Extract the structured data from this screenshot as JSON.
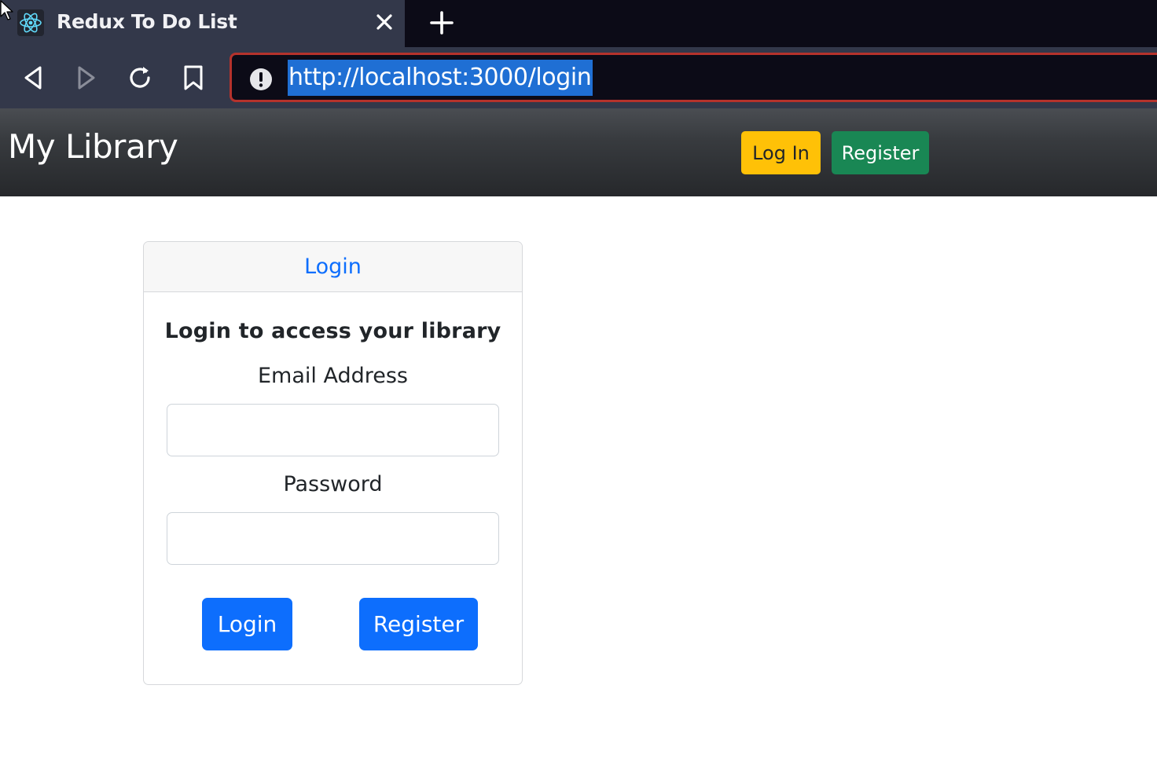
{
  "browser": {
    "tab": {
      "title": "Redux To Do List",
      "favicon": "react-atom-icon"
    },
    "new_tab_icon": "plus-icon",
    "toolbar": {
      "back_icon": "back-triangle-icon",
      "forward_icon": "forward-triangle-icon",
      "reload_icon": "reload-icon",
      "bookmark_icon": "bookmark-icon",
      "info_icon": "info-exclamation-icon",
      "url": "http://localhost:3000/login"
    },
    "colors": {
      "chrome": "#33384a",
      "tabstrip": "#0c0b17",
      "url_border": "#b5322c",
      "url_selection": "#1f6fd4"
    }
  },
  "navbar": {
    "brand": "My Library",
    "login_label": "Log In",
    "register_label": "Register",
    "colors": {
      "login": "#ffc107",
      "register": "#198754"
    }
  },
  "card": {
    "header": "Login",
    "subtitle": "Login to access your library",
    "email_label": "Email Address",
    "email_value": "",
    "password_label": "Password",
    "password_value": "",
    "login_button": "Login",
    "register_button": "Register",
    "colors": {
      "primary": "#0d6efd"
    }
  }
}
